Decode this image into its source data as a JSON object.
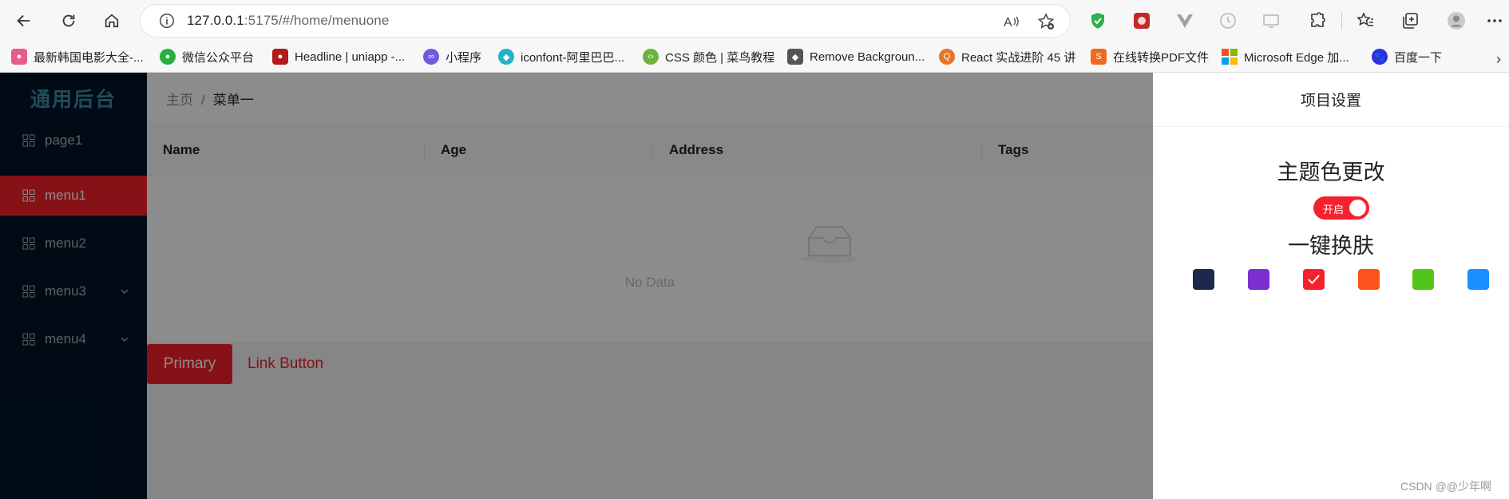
{
  "browser": {
    "url_host": "127.0.0.1",
    "url_rest": ":5175/#/home/menuone"
  },
  "bookmarks": [
    {
      "label": "最新韩国电影大全-...",
      "color": "#e85c8a"
    },
    {
      "label": "微信公众平台",
      "color": "#2aae3f"
    },
    {
      "label": "Headline | uniapp -...",
      "color": "#b31a1a"
    },
    {
      "label": "小程序",
      "color": "#6b5be0"
    },
    {
      "label": "iconfont-阿里巴巴...",
      "color": "#21b4c9"
    },
    {
      "label": "CSS 颜色 | 菜鸟教程",
      "color": "#6db33f"
    },
    {
      "label": "Remove Backgroun...",
      "color": "#555555"
    },
    {
      "label": "React 实战进阶 45 讲",
      "color": "#e8742a"
    },
    {
      "label": "在线转换PDF文件",
      "color": "#ef6a20"
    },
    {
      "label": "Microsoft Edge 加...",
      "color": "#f25022"
    },
    {
      "label": "百度一下",
      "color": "#2932e1"
    }
  ],
  "app": {
    "logo": "通用后台",
    "menu": [
      {
        "label": "page1",
        "active": false,
        "has_arrow": false
      },
      {
        "label": "menu1",
        "active": true,
        "has_arrow": false
      },
      {
        "label": "menu2",
        "active": false,
        "has_arrow": false
      },
      {
        "label": "menu3",
        "active": false,
        "has_arrow": true
      },
      {
        "label": "menu4",
        "active": false,
        "has_arrow": true
      }
    ],
    "breadcrumb": {
      "home": "主页",
      "separator": "/",
      "current": "菜单一"
    },
    "table": {
      "columns": [
        "Name",
        "Age",
        "Address",
        "Tags"
      ],
      "empty_text": "No Data"
    },
    "buttons": {
      "primary": "Primary",
      "link": "Link Button"
    },
    "accent_color": "#f5222d"
  },
  "drawer": {
    "title": "项目设置",
    "theme_title": "主题色更改",
    "switch_label": "开启",
    "switch_on": true,
    "skin_title": "一键换肤",
    "swatches": [
      {
        "color": "#1b2a4a",
        "selected": false
      },
      {
        "color": "#7b2fd1",
        "selected": false
      },
      {
        "color": "#f5222d",
        "selected": true
      },
      {
        "color": "#fa541c",
        "selected": false
      },
      {
        "color": "#52c41a",
        "selected": false
      },
      {
        "color": "#1890ff",
        "selected": false
      }
    ]
  },
  "watermark": "CSDN @@少年啊"
}
